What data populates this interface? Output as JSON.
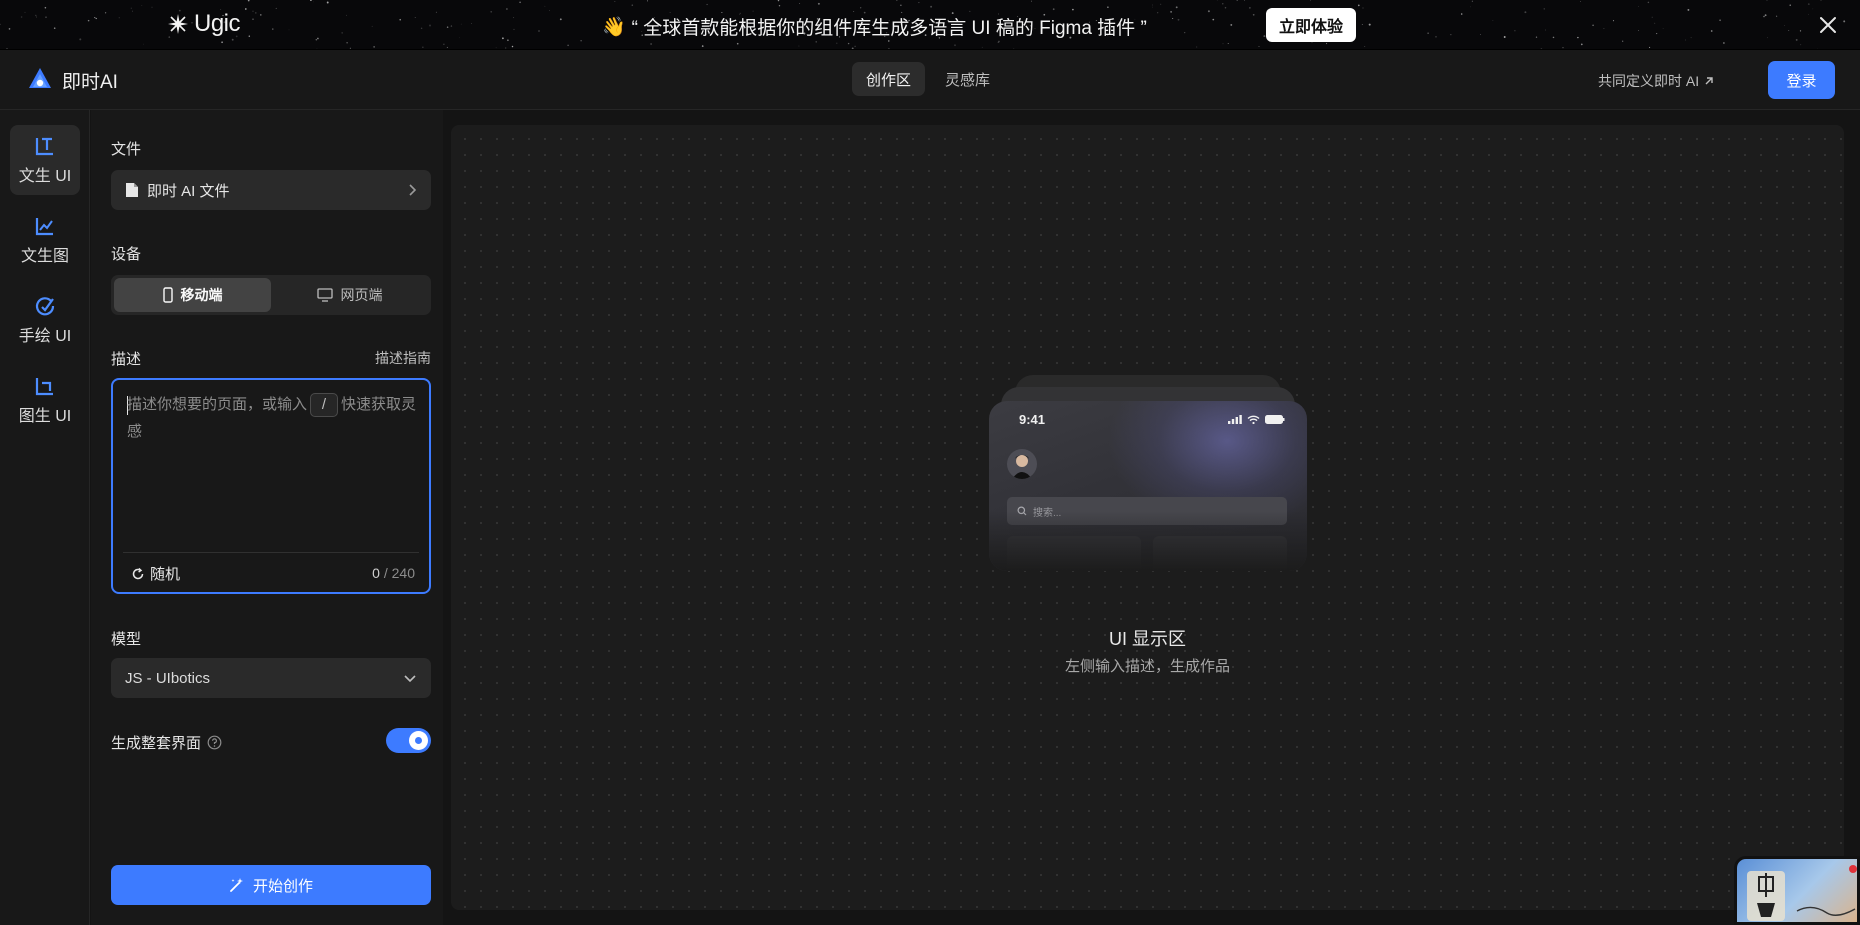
{
  "banner": {
    "logo_text": "Ugic",
    "emoji": "👋",
    "message": "“ 全球首款能根据你的组件库生成多语言 UI 稿的 Figma 插件 ”",
    "cta_label": "立即体验"
  },
  "header": {
    "brand": "即时AI",
    "tabs": [
      {
        "label": "创作区",
        "active": true
      },
      {
        "label": "灵感库",
        "active": false
      }
    ],
    "cocreate_label": "共同定义即时 AI",
    "login_label": "登录"
  },
  "rail": {
    "items": [
      {
        "label": "文生 UI",
        "icon": "text-to-ui-icon",
        "active": true
      },
      {
        "label": "文生图",
        "icon": "text-to-image-icon",
        "active": false
      },
      {
        "label": "手绘 UI",
        "icon": "sketch-ui-icon",
        "active": false
      },
      {
        "label": "图生 UI",
        "icon": "image-to-ui-icon",
        "active": false
      }
    ]
  },
  "panel": {
    "file_label": "文件",
    "file_value": "即时 AI 文件",
    "device_label": "设备",
    "devices": [
      {
        "label": "移动端",
        "active": true
      },
      {
        "label": "网页端",
        "active": false
      }
    ],
    "desc_label": "描述",
    "desc_guide": "描述指南",
    "desc_placeholder_a": "描述你想要的页面，或输入",
    "desc_slash": "/",
    "desc_placeholder_b": "快速获取灵感",
    "random_label": "随机",
    "count_current": "0",
    "count_max": "/ 240",
    "model_label": "模型",
    "model_value": "JS - UIbotics",
    "fullset_label": "生成整套界面",
    "fullset_enabled": true,
    "start_label": "开始创作"
  },
  "canvas": {
    "preview": {
      "time": "9:41",
      "search_placeholder": "搜索..."
    },
    "empty_title": "UI 显示区",
    "empty_subtitle": "左侧输入描述，生成作品"
  },
  "colors": {
    "accent": "#3d7bff",
    "background": "#141414",
    "panel": "#181818",
    "canvas": "#1c1c1c"
  }
}
